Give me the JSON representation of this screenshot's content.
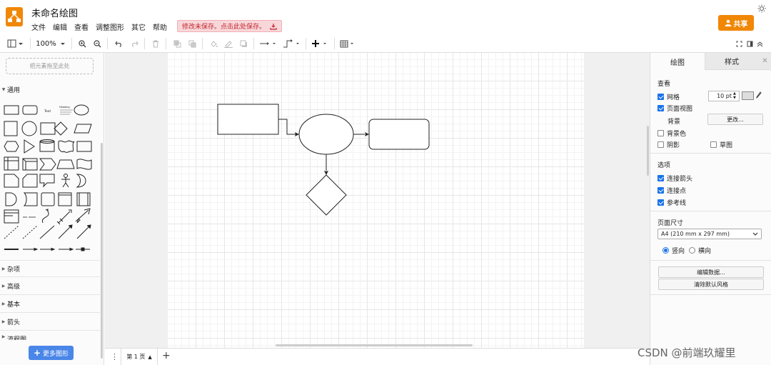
{
  "app": {
    "title": "未命名绘图",
    "share": "共享",
    "unsaved": "修改未保存。点击此处保存。"
  },
  "menus": [
    "文件",
    "编辑",
    "查看",
    "调整图形",
    "其它",
    "帮助"
  ],
  "toolbar": {
    "zoom": "100%"
  },
  "left": {
    "drop_hint": "把元素拖至此处",
    "sections": {
      "general": "通用",
      "misc": "杂项",
      "advanced": "高级",
      "basic": "基本",
      "arrows": "箭头",
      "flowchart": "流程图"
    },
    "more_shapes": "更多图形",
    "text_shape": "Text",
    "heading_shape": "Heading"
  },
  "pages": {
    "tab": "第 1 页"
  },
  "right": {
    "tabs": {
      "diagram": "绘图",
      "style": "样式"
    },
    "view": {
      "heading": "查看",
      "grid": "网格",
      "grid_size": "10 pt",
      "page_view": "页面视图",
      "background": "背景",
      "change": "更改...",
      "background_color": "背景色",
      "shadow": "阴影",
      "sketch": "草图"
    },
    "options": {
      "heading": "选项",
      "connection_arrows": "连接箭头",
      "connection_points": "连接点",
      "guides": "参考线"
    },
    "page_size": {
      "heading": "页面尺寸",
      "value": "A4 (210 mm x 297 mm)",
      "portrait": "竖向",
      "landscape": "横向"
    },
    "edit_data": "编辑数据...",
    "clear_style": "清除默认风格"
  },
  "watermark": "CSDN @前端玖耀里",
  "colors": {
    "accent": "#f08705",
    "blue": "#4a86e8"
  }
}
